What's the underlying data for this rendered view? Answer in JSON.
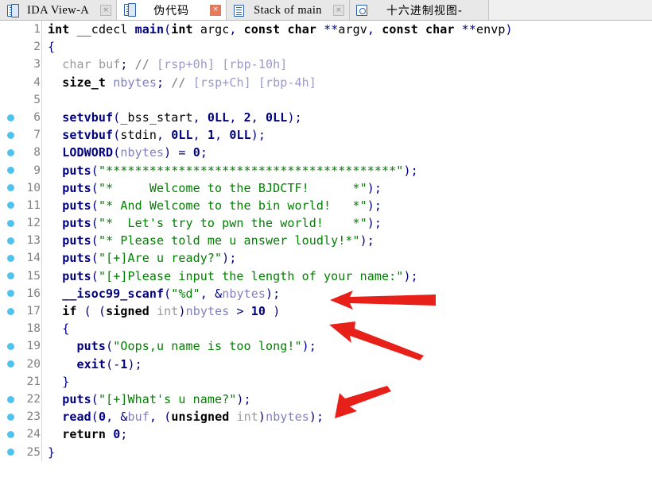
{
  "window": {
    "app": "IDA Pro",
    "view": "Pseudocode"
  },
  "tabs": [
    {
      "label": "IDA View-A",
      "icon": "document-icon",
      "close_label": "×",
      "active": false,
      "cjk": false
    },
    {
      "label": "伪代码",
      "icon": "document-icon",
      "close_label": "×",
      "active": true,
      "cjk": true
    },
    {
      "label": "Stack of main",
      "icon": "stack-icon",
      "close_label": "×",
      "active": false,
      "cjk": false
    },
    {
      "label": "十六进制视图-",
      "icon": "hex-icon",
      "close_label": "",
      "active": false,
      "cjk": true
    }
  ],
  "code": {
    "language": "c-pseudocode",
    "lines": [
      {
        "n": "1",
        "bp": false,
        "text": "int __cdecl main(int argc, const char **argv, const char **envp)"
      },
      {
        "n": "2",
        "bp": false,
        "text": "{"
      },
      {
        "n": "3",
        "bp": false,
        "text": "  char buf; // [rsp+0h] [rbp-10h]"
      },
      {
        "n": "4",
        "bp": false,
        "text": "  size_t nbytes; // [rsp+Ch] [rbp-4h]"
      },
      {
        "n": "5",
        "bp": false,
        "text": ""
      },
      {
        "n": "6",
        "bp": true,
        "text": "  setvbuf(_bss_start, 0LL, 2, 0LL);"
      },
      {
        "n": "7",
        "bp": true,
        "text": "  setvbuf(stdin, 0LL, 1, 0LL);"
      },
      {
        "n": "8",
        "bp": true,
        "text": "  LODWORD(nbytes) = 0;"
      },
      {
        "n": "9",
        "bp": true,
        "text": "  puts(\"****************************************\");"
      },
      {
        "n": "10",
        "bp": true,
        "text": "  puts(\"*     Welcome to the BJDCTF!      *\");"
      },
      {
        "n": "11",
        "bp": true,
        "text": "  puts(\"* And Welcome to the bin world!   *\");"
      },
      {
        "n": "12",
        "bp": true,
        "text": "  puts(\"*  Let's try to pwn the world!    *\");"
      },
      {
        "n": "13",
        "bp": true,
        "text": "  puts(\"* Please told me u answer loudly!*\");"
      },
      {
        "n": "14",
        "bp": true,
        "text": "  puts(\"[+]Are u ready?\");"
      },
      {
        "n": "15",
        "bp": true,
        "text": "  puts(\"[+]Please input the length of your name:\");"
      },
      {
        "n": "16",
        "bp": true,
        "text": "  __isoc99_scanf(\"%d\", &nbytes);"
      },
      {
        "n": "17",
        "bp": true,
        "text": "  if ( (signed int)nbytes > 10 )"
      },
      {
        "n": "18",
        "bp": false,
        "text": "  {"
      },
      {
        "n": "19",
        "bp": true,
        "text": "    puts(\"Oops,u name is too long!\");"
      },
      {
        "n": "20",
        "bp": true,
        "text": "    exit(-1);"
      },
      {
        "n": "21",
        "bp": false,
        "text": "  }"
      },
      {
        "n": "22",
        "bp": true,
        "text": "  puts(\"[+]What's u name?\");"
      },
      {
        "n": "23",
        "bp": true,
        "text": "  read(0, &buf, (unsigned int)nbytes);"
      },
      {
        "n": "24",
        "bp": true,
        "text": "  return 0;"
      },
      {
        "n": "25",
        "bp": true,
        "text": "}"
      }
    ]
  },
  "annotations": {
    "color": "#e8201a",
    "arrows": [
      {
        "name": "arrow-scanf-nbytes",
        "target_line": "16",
        "points_to": "&nbytes"
      },
      {
        "name": "arrow-length-check",
        "target_line": "17",
        "points_to": "(signed int)nbytes > 10"
      },
      {
        "name": "arrow-read-overflow",
        "target_line": "23",
        "points_to": "read(0, &buf, nbytes)"
      }
    ]
  },
  "colors": {
    "keyword": "#000080",
    "string": "#008000",
    "variable": "#8080c0",
    "comment": "#808080",
    "linenumber": "#808080",
    "breakpoint_dot": "#4fc3f0",
    "arrow": "#e8201a",
    "background": "#ffffff"
  }
}
